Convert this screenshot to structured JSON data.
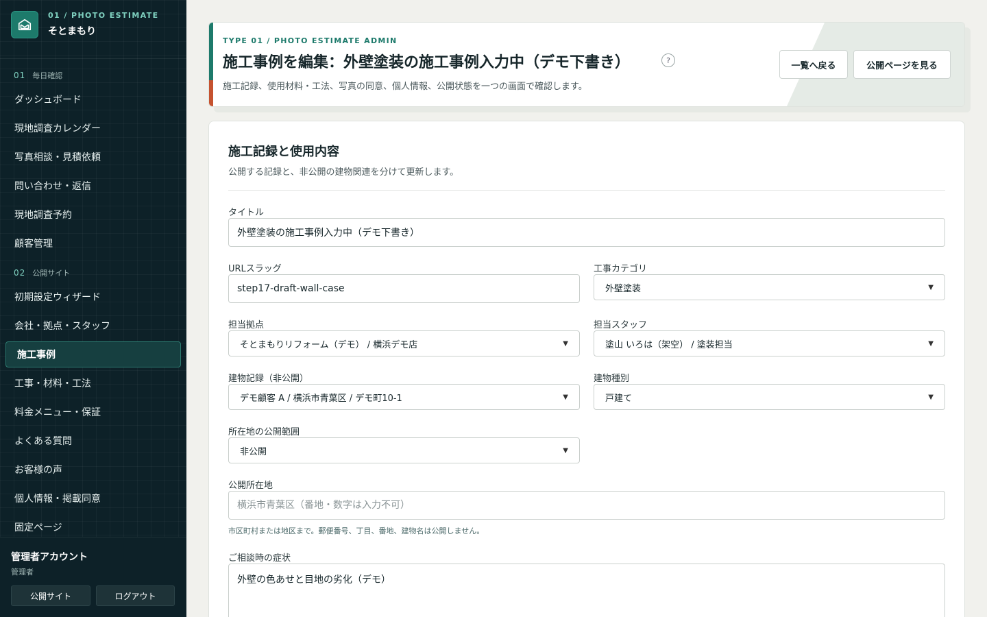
{
  "brand": {
    "kicker": "01 / PHOTO ESTIMATE",
    "name": "そとまもり"
  },
  "sidebar": {
    "groups": [
      {
        "num": "01",
        "label": "毎日確認",
        "items": [
          "ダッシュボード",
          "現地調査カレンダー",
          "写真相談・見積依頼",
          "問い合わせ・返信",
          "現地調査予約",
          "顧客管理"
        ]
      },
      {
        "num": "02",
        "label": "公開サイト",
        "items": [
          "初期設定ウィザード",
          "会社・拠点・スタッフ",
          "施工事例",
          "工事・材料・工法",
          "料金メニュー・保証",
          "よくある質問",
          "お客様の声",
          "個人情報・掲載同意",
          "固定ページ"
        ]
      }
    ],
    "active_item": "施工事例"
  },
  "account": {
    "name": "管理者アカウント",
    "role": "管理者",
    "public_site_label": "公開サイト",
    "logout_label": "ログアウト"
  },
  "header": {
    "kicker": "TYPE 01 / PHOTO ESTIMATE ADMIN",
    "title": "施工事例を編集：外壁塗装の施工事例入力中（デモ下書き）",
    "help": "?",
    "subtitle": "施工記録、使用材料・工法、写真の同意、個人情報、公開状態を一つの画面で確認します。",
    "back_button": "一覧へ戻る",
    "view_public_button": "公開ページを見る"
  },
  "form": {
    "section_title": "施工記録と使用内容",
    "section_subtitle": "公開する記録と、非公開の建物関連を分けて更新します。",
    "title_label": "タイトル",
    "title_value": "外壁塗装の施工事例入力中（デモ下書き）",
    "slug_label": "URLスラッグ",
    "slug_value": "step17-draft-wall-case",
    "category_label": "工事カテゴリ",
    "category_value": "外壁塗装",
    "branch_label": "担当拠点",
    "branch_value": "そとまもりリフォーム（デモ） / 横浜デモ店",
    "staff_label": "担当スタッフ",
    "staff_value": "塗山 いろは（架空） / 塗装担当",
    "building_label": "建物記録（非公開）",
    "building_value": "デモ顧客 A / 横浜市青葉区 / デモ町10-1",
    "building_type_label": "建物種別",
    "building_type_value": "戸建て",
    "location_scope_label": "所在地の公開範囲",
    "location_scope_value": "非公開",
    "public_location_label": "公開所在地",
    "public_location_placeholder": "横浜市青葉区（番地・数字は入力不可）",
    "public_location_help": "市区町村または地区まで。郵便番号、丁目、番地、建物名は公開しません。",
    "symptom_label": "ご相談時の症状",
    "symptom_value": "外壁の色あせと目地の劣化（デモ）"
  }
}
